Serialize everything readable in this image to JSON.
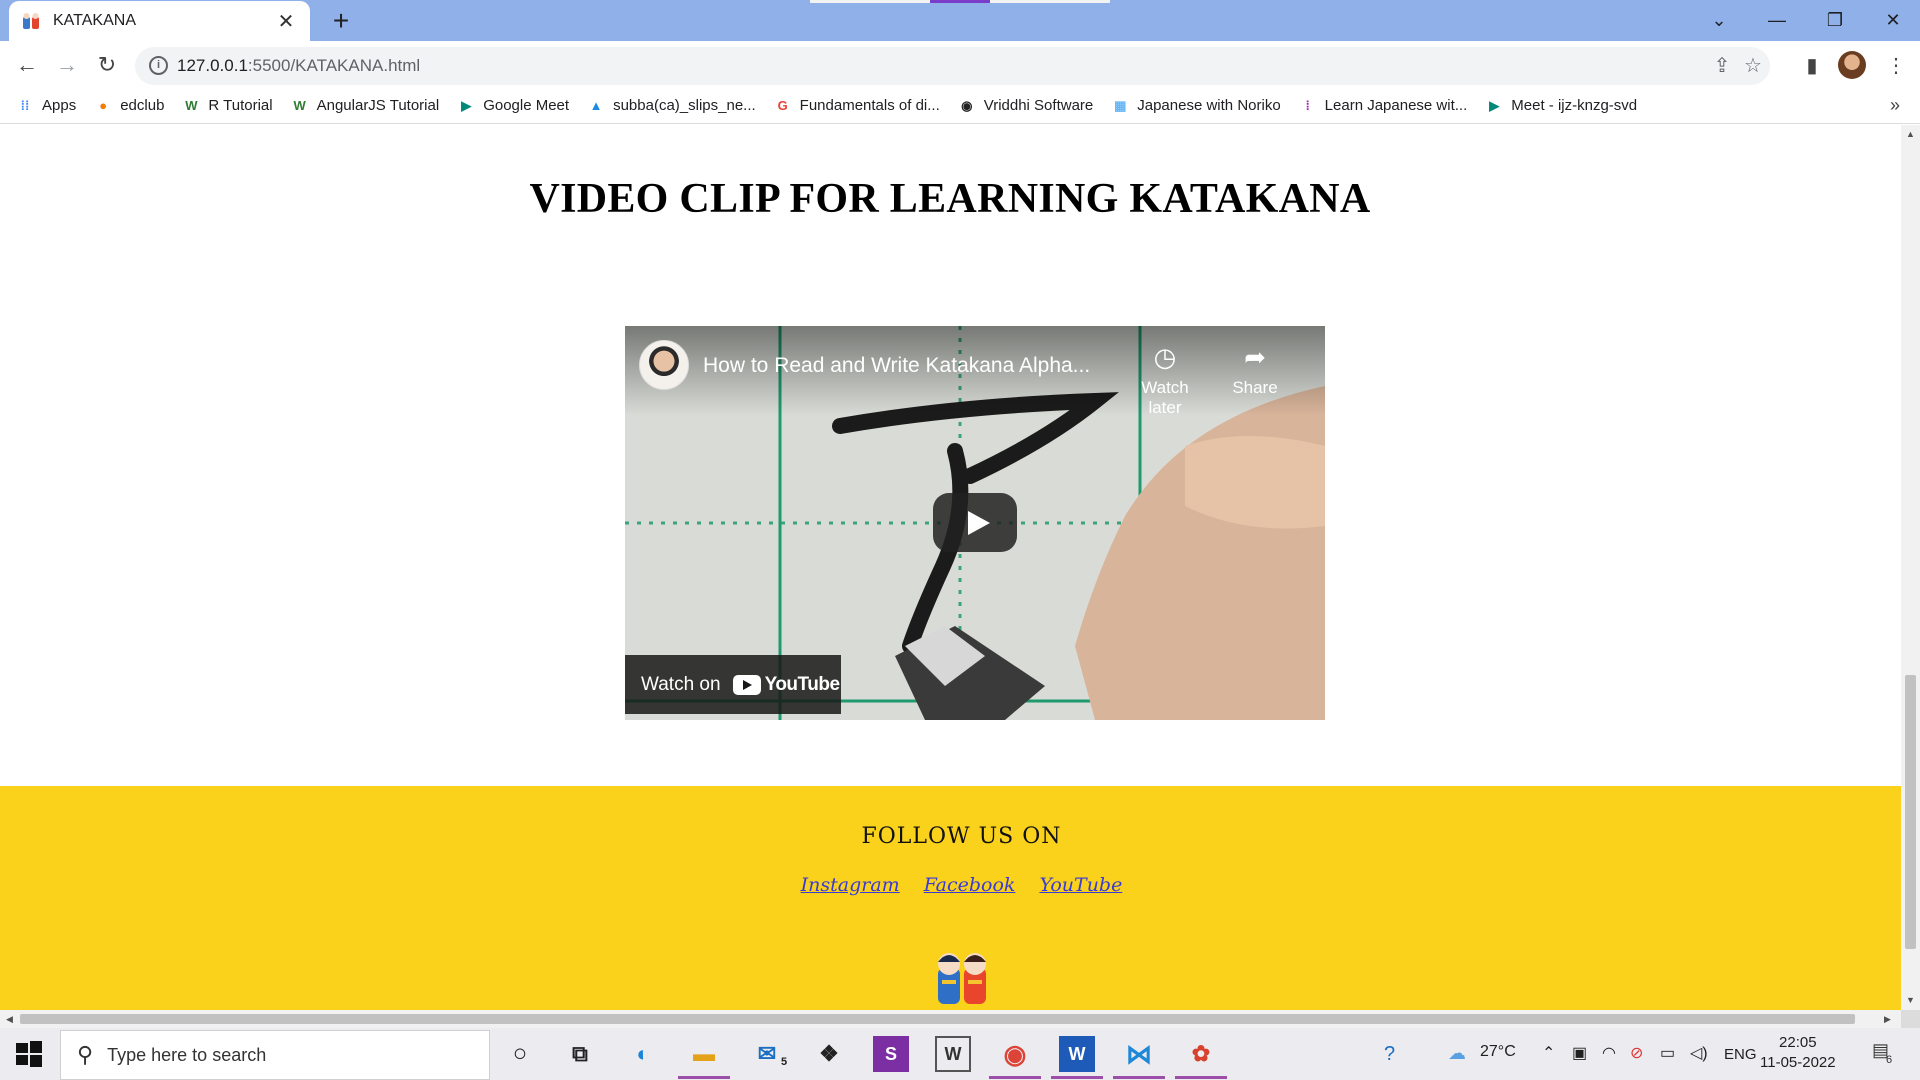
{
  "browser": {
    "tab": {
      "title": "KATAKANA",
      "favicon": "katakana-doll-icon"
    },
    "url": {
      "host": "127.0.0.1",
      "path": ":5500/KATAKANA.html"
    },
    "bookmarks": [
      {
        "label": "Apps",
        "icon": "apps-grid-icon",
        "color": "#4285f4"
      },
      {
        "label": "edclub",
        "icon": "edclub-icon",
        "color": "#f57c00"
      },
      {
        "label": "R Tutorial",
        "icon": "w3-icon",
        "color": "#2e7d32"
      },
      {
        "label": "AngularJS Tutorial",
        "icon": "w3-icon",
        "color": "#2e7d32"
      },
      {
        "label": "Google Meet",
        "icon": "meet-icon",
        "color": "#00897b"
      },
      {
        "label": "subba(ca)_slips_ne...",
        "icon": "drive-icon",
        "color": "#1e88e5"
      },
      {
        "label": "Fundamentals of di...",
        "icon": "google-icon",
        "color": "#ea4335"
      },
      {
        "label": "Vriddhi Software",
        "icon": "vriddhi-icon",
        "color": "#222222"
      },
      {
        "label": "Japanese with Noriko",
        "icon": "noriko-icon",
        "color": "#64b5f6"
      },
      {
        "label": "Learn Japanese wit...",
        "icon": "learn-japanese-icon",
        "color": "#9c27b0"
      },
      {
        "label": "Meet - ijz-knzg-svd",
        "icon": "meet-icon",
        "color": "#00897b"
      }
    ]
  },
  "page": {
    "heading": "VIDEO CLIP FOR LEARNING KATAKANA",
    "video": {
      "title": "How to Read and Write Katakana Alpha...",
      "watch_later": "Watch later",
      "share": "Share",
      "watch_on": "Watch on",
      "youtube": "YouTube"
    },
    "footer": {
      "follow": "FOLLOW US ON",
      "links": [
        "Instagram",
        "Facebook",
        "YouTube"
      ]
    }
  },
  "taskbar": {
    "search_placeholder": "Type here to search",
    "weather": "27°C",
    "language": "ENG",
    "time": "22:05",
    "date": "11-05-2022",
    "mail_badge": "5",
    "notification_count": "6"
  },
  "colors": {
    "tabbar": "#8fb0e8",
    "footer": "#fad21b",
    "link": "#3a3ad8"
  }
}
